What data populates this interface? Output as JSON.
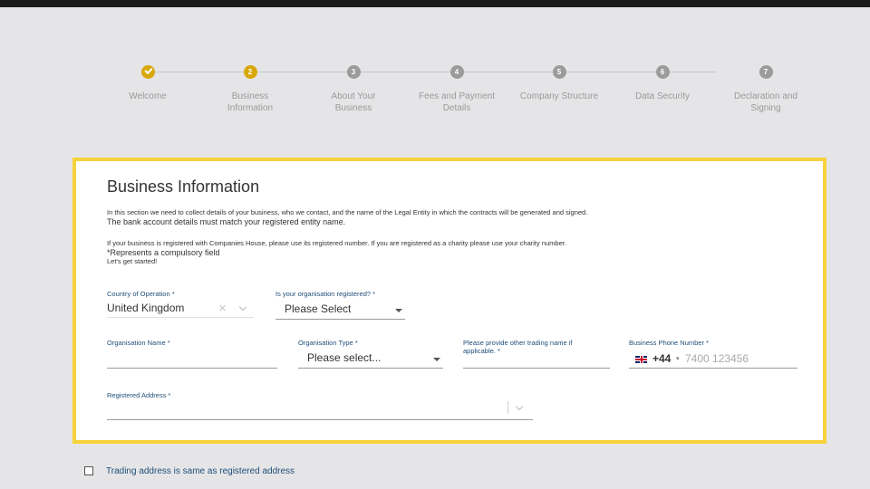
{
  "stepper": {
    "steps": [
      {
        "number": "",
        "label_lines": [
          "Welcome",
          ""
        ],
        "state": "done"
      },
      {
        "number": "2",
        "label_lines": [
          "Business",
          "Information"
        ],
        "state": "active"
      },
      {
        "number": "3",
        "label_lines": [
          "About Your",
          "Business"
        ],
        "state": "pending"
      },
      {
        "number": "4",
        "label_lines": [
          "Fees and Payment",
          "Details"
        ],
        "state": "pending"
      },
      {
        "number": "5",
        "label_lines": [
          "Company Structure",
          ""
        ],
        "state": "pending"
      },
      {
        "number": "6",
        "label_lines": [
          "Data Security",
          ""
        ],
        "state": "pending"
      },
      {
        "number": "7",
        "label_lines": [
          "Declaration and",
          "Signing"
        ],
        "state": "pending"
      }
    ]
  },
  "form": {
    "title": "Business Information",
    "intro": {
      "line1": "In this section we need to collect details of your business, who we contact, and the name of the Legal Entity in which the contracts will be generated and signed.",
      "line2": "The bank account details must match your registered entity name.",
      "line3": "If your business is registered with Companies House, please use its registered number. If you are registered as a charity please use your charity number.",
      "line4": "*Represents a compulsory field",
      "line5": "Let's get started!"
    },
    "country": {
      "label": "Country of Operation *",
      "value": "United Kingdom"
    },
    "registered": {
      "label": "Is your organisation registered? *",
      "value": "Please Select"
    },
    "org_name": {
      "label": "Organisation Name *",
      "value": ""
    },
    "org_type": {
      "label": "Organisation Type *",
      "value": "Please select..."
    },
    "trading_name": {
      "label_line1": "Please provide other trading name if",
      "label_line2": "applicable. *",
      "value": ""
    },
    "phone": {
      "label": "Business Phone Number *",
      "code": "+44",
      "placeholder": "7400 123456"
    },
    "address": {
      "label": "Registered Address *",
      "value": ""
    }
  },
  "trading_same": {
    "label": "Trading address is same as registered address",
    "checked": false
  },
  "colors": {
    "accent": "#d9a70a",
    "highlight_border": "#f7d23b",
    "label_blue": "#1f4e79"
  }
}
